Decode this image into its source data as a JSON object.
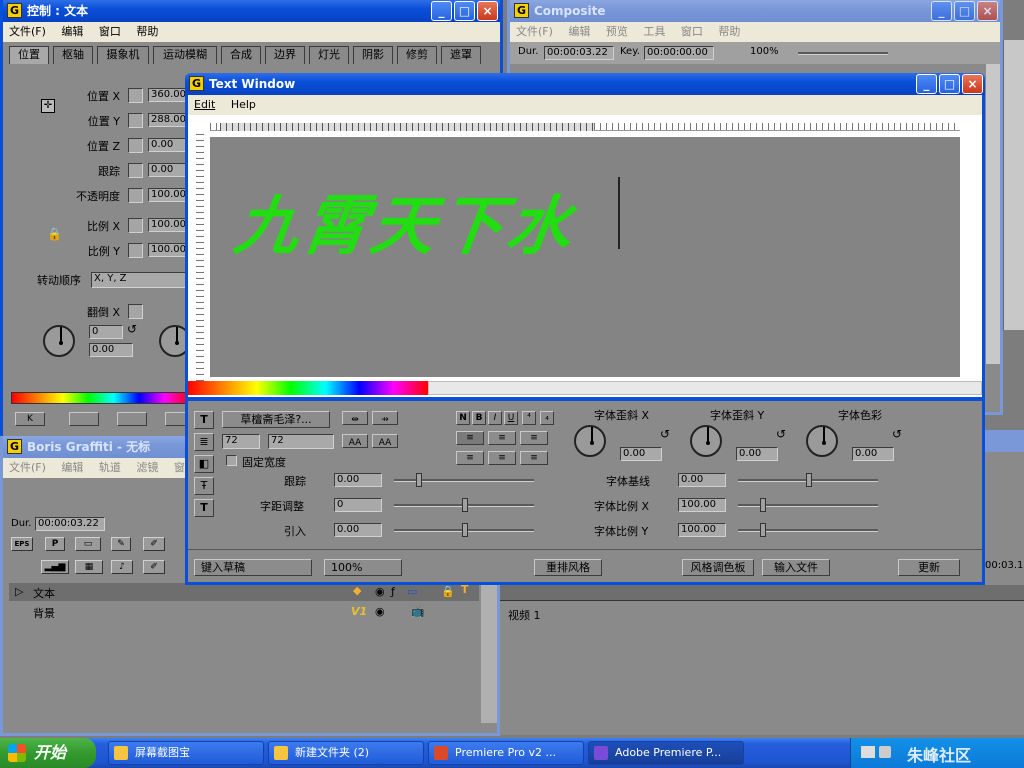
{
  "control_window": {
    "title": "控制 : 文本",
    "menu": [
      "文件(F)",
      "编辑",
      "窗口",
      "帮助"
    ],
    "tabs": [
      "位置",
      "枢轴",
      "摄象机",
      "运动模糊",
      "合成",
      "边界",
      "灯光",
      "阴影",
      "修剪",
      "遮罩"
    ],
    "rows": [
      {
        "label": "位置 X",
        "value": "360.00"
      },
      {
        "label": "位置 Y",
        "value": "288.00"
      },
      {
        "label": "位置 Z",
        "value": "0.00"
      },
      {
        "label": "跟踪",
        "value": "0.00"
      },
      {
        "label": "不透明度",
        "value": "100.00"
      },
      {
        "label": "比例 X",
        "value": "100.00"
      },
      {
        "label": "比例 Y",
        "value": "100.00"
      }
    ],
    "rotation_order_label": "转动顺序",
    "rotation_order_value": "X, Y, Z",
    "flip_label": "翻倒 X",
    "dial_value_1": "0",
    "dial_value_2": "0.00",
    "bottom_buttons": [
      "K",
      "",
      "",
      ""
    ]
  },
  "composite_window": {
    "title": "Composite",
    "menu": [
      "文件(F)",
      "编辑",
      "预览",
      "工具",
      "窗口",
      "帮助"
    ],
    "dur_label": "Dur.",
    "dur_value": "00:00:03.22",
    "key_label": "Key.",
    "key_value": "00:00:00.00",
    "zoom": "100%"
  },
  "boris_window": {
    "title": "Boris Graffiti - 无标",
    "menu": [
      "文件(F)",
      "编辑",
      "轨道",
      "滤镜",
      "窗"
    ],
    "dur_label": "Dur.",
    "dur_value": "00:00:03.22",
    "eps_label": "EPS",
    "tracks": [
      {
        "name": "文本",
        "tag": ""
      },
      {
        "name": "背景",
        "tag": "V1"
      }
    ],
    "right_time": "00:03.1",
    "video_track_label": "视频 1"
  },
  "text_window": {
    "title": "Text Window",
    "menu": [
      "Edit",
      "Help"
    ],
    "canvas_text": "九霄天下水",
    "text_color": "#22dd11",
    "font_button": "草檀斋毛泽?...",
    "font_size_1": "72",
    "font_size_2": "72",
    "fixed_width_label": "固定宽度",
    "style_buttons": [
      "N",
      "B",
      "I",
      "U"
    ],
    "size_buttons": [
      "AA",
      "AA"
    ],
    "tracking_label": "跟踪",
    "tracking_value": "0.00",
    "kerning_label": "字距调整",
    "kerning_value": "0",
    "leading_label": "引入",
    "leading_value": "0.00",
    "skew_x_label": "字体歪斜 X",
    "skew_x_value": "0.00",
    "skew_y_label": "字体歪斜 Y",
    "skew_y_value": "0.00",
    "font_color_label": "字体色彩",
    "font_color_value": "0.00",
    "baseline_label": "字体基线",
    "baseline_value": "0.00",
    "scale_x_label": "字体比例 X",
    "scale_x_value": "100.00",
    "scale_y_label": "字体比例 Y",
    "scale_y_value": "100.00",
    "footer": {
      "type_draft": "键入草稿",
      "zoom": "100%",
      "reflow_style": "重排风格",
      "style_palette": "风格调色板",
      "import_file": "输入文件",
      "update": "更新"
    }
  },
  "taskbar": {
    "start": "开始",
    "tasks": [
      {
        "label": "屏幕截图宝",
        "icon_color": "#f5c542"
      },
      {
        "label": "新建文件夹 (2)",
        "icon_color": "#f5c542"
      },
      {
        "label": "Premiere Pro v2 ...",
        "icon_color": "#d84a2a"
      },
      {
        "label": "Adobe Premiere P...",
        "icon_color": "#7a4ad8"
      }
    ],
    "watermark": "朱峰社区"
  }
}
